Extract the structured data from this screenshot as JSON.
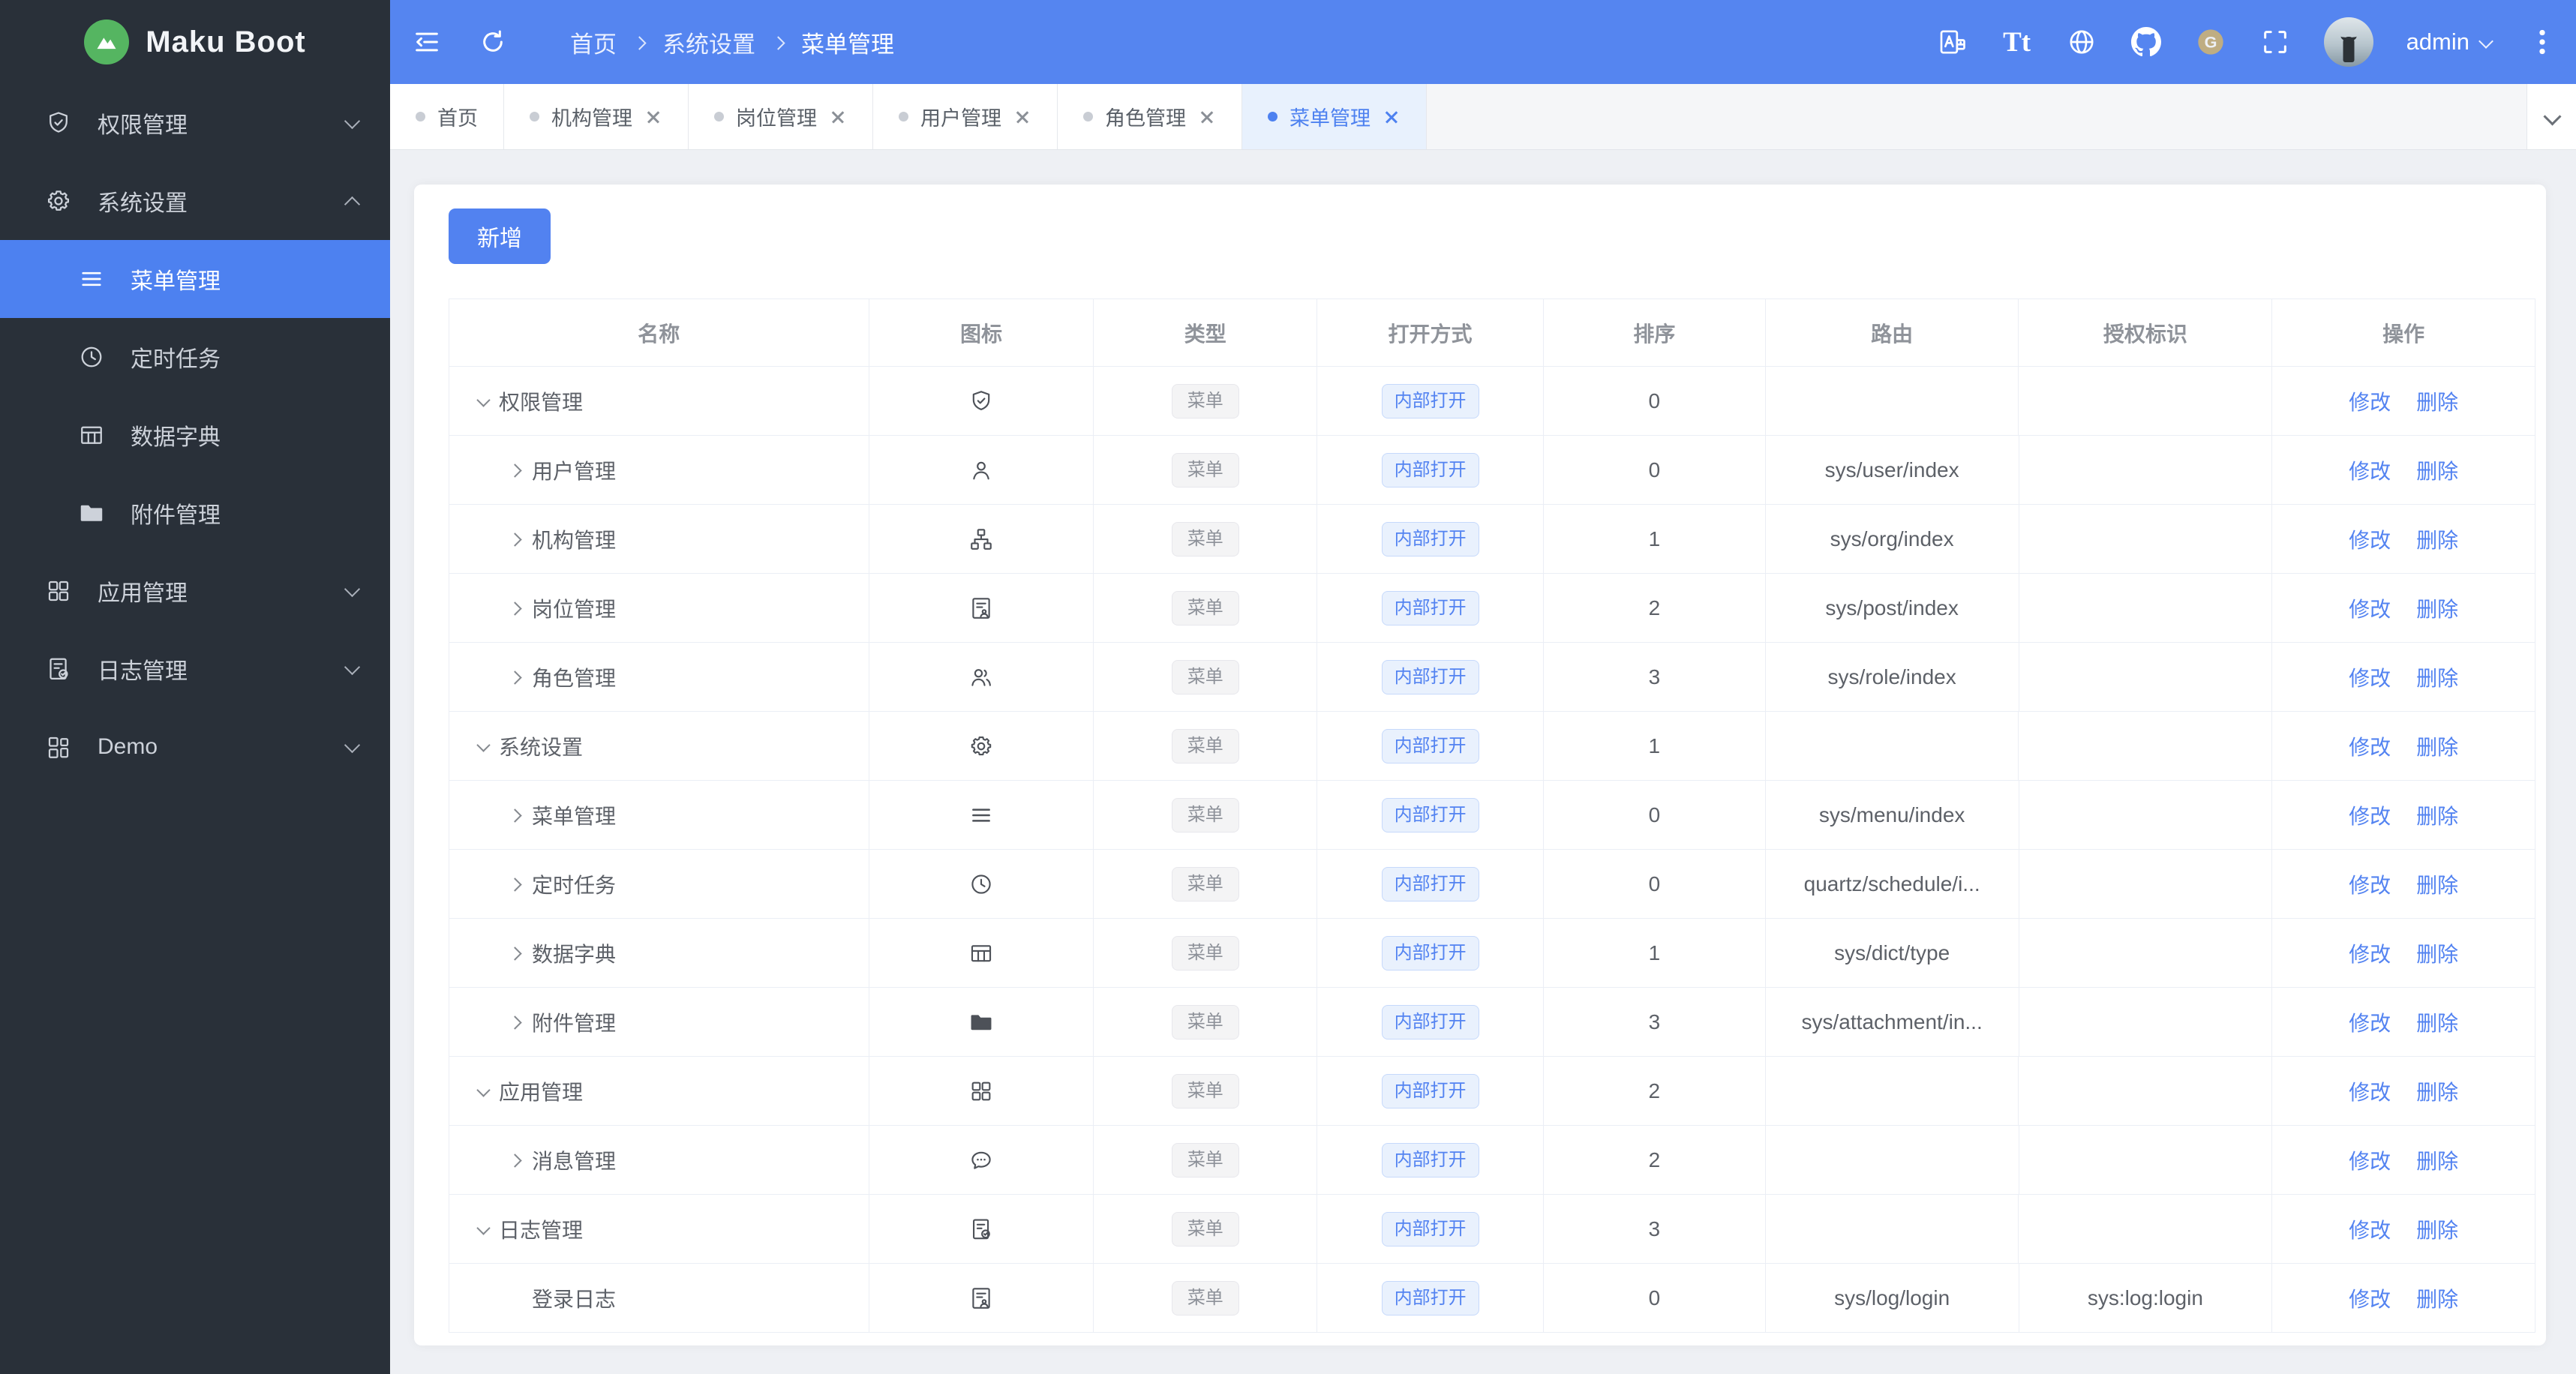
{
  "colors": {
    "primary": "#5282f0",
    "header_bg": "#5585f0",
    "sidebar_bg": "#293039",
    "sidebar_active_bg": "#4d81f0",
    "page_bg": "#eef0f4",
    "tab_active_bg": "#e8f1fd",
    "tag_info_bg": "#f4f4f5",
    "tag_primary_bg": "#e9f1fd",
    "logo_green": "#55b561",
    "gitee_gold": "#bfad82"
  },
  "brand": {
    "logo_text": "Maku Boot",
    "logo_icon": "mountain-icon"
  },
  "header": {
    "breadcrumb": {
      "items": [
        "首页",
        "系统设置",
        "菜单管理"
      ]
    },
    "left_icons": [
      "collapse-sidebar-icon",
      "refresh-icon"
    ],
    "right_icons": [
      "translate-icon",
      "font-size-icon",
      "globe-icon",
      "github-icon",
      "gitee-icon",
      "fullscreen-icon",
      "kebab-menu-icon"
    ],
    "font_size_glyph": "Tt",
    "gitee_letter": "G",
    "user": {
      "name": "admin"
    }
  },
  "sidebar": {
    "items": [
      {
        "label": "权限管理",
        "icon": "shield",
        "state": "collapsed"
      },
      {
        "label": "系统设置",
        "icon": "gear",
        "state": "expanded",
        "children": [
          {
            "label": "菜单管理",
            "icon": "menu",
            "active": true
          },
          {
            "label": "定时任务",
            "icon": "clock",
            "active": false
          },
          {
            "label": "数据字典",
            "icon": "dict",
            "active": false
          },
          {
            "label": "附件管理",
            "icon": "folder",
            "active": false
          }
        ]
      },
      {
        "label": "应用管理",
        "icon": "apps",
        "state": "collapsed"
      },
      {
        "label": "日志管理",
        "icon": "log",
        "state": "collapsed"
      },
      {
        "label": "Demo",
        "icon": "demo",
        "state": "collapsed"
      }
    ]
  },
  "tabs": {
    "items": [
      {
        "label": "首页",
        "closable": false,
        "active": false
      },
      {
        "label": "机构管理",
        "closable": true,
        "active": false
      },
      {
        "label": "岗位管理",
        "closable": true,
        "active": false
      },
      {
        "label": "用户管理",
        "closable": true,
        "active": false
      },
      {
        "label": "角色管理",
        "closable": true,
        "active": false
      },
      {
        "label": "菜单管理",
        "closable": true,
        "active": true
      }
    ]
  },
  "toolbar": {
    "add_label": "新增"
  },
  "table": {
    "headers": [
      "名称",
      "图标",
      "类型",
      "打开方式",
      "排序",
      "路由",
      "授权标识",
      "操作"
    ],
    "actions": {
      "modify": "修改",
      "delete": "删除"
    },
    "rows": [
      {
        "name": "权限管理",
        "icon": "shield",
        "level": 1,
        "expand": "expanded",
        "type": "菜单",
        "open": "内部打开",
        "sort": 0,
        "route": "",
        "auth": ""
      },
      {
        "name": "用户管理",
        "icon": "user",
        "level": 2,
        "expand": "collapsed",
        "type": "菜单",
        "open": "内部打开",
        "sort": 0,
        "route": "sys/user/index",
        "auth": ""
      },
      {
        "name": "机构管理",
        "icon": "org",
        "level": 2,
        "expand": "collapsed",
        "type": "菜单",
        "open": "内部打开",
        "sort": 1,
        "route": "sys/org/index",
        "auth": ""
      },
      {
        "name": "岗位管理",
        "icon": "post",
        "level": 2,
        "expand": "collapsed",
        "type": "菜单",
        "open": "内部打开",
        "sort": 2,
        "route": "sys/post/index",
        "auth": ""
      },
      {
        "name": "角色管理",
        "icon": "role",
        "level": 2,
        "expand": "collapsed",
        "type": "菜单",
        "open": "内部打开",
        "sort": 3,
        "route": "sys/role/index",
        "auth": ""
      },
      {
        "name": "系统设置",
        "icon": "gear",
        "level": 1,
        "expand": "expanded",
        "type": "菜单",
        "open": "内部打开",
        "sort": 1,
        "route": "",
        "auth": ""
      },
      {
        "name": "菜单管理",
        "icon": "menu",
        "level": 2,
        "expand": "collapsed",
        "type": "菜单",
        "open": "内部打开",
        "sort": 0,
        "route": "sys/menu/index",
        "auth": ""
      },
      {
        "name": "定时任务",
        "icon": "clock",
        "level": 2,
        "expand": "collapsed",
        "type": "菜单",
        "open": "内部打开",
        "sort": 0,
        "route": "quartz/schedule/i...",
        "auth": ""
      },
      {
        "name": "数据字典",
        "icon": "dict",
        "level": 2,
        "expand": "collapsed",
        "type": "菜单",
        "open": "内部打开",
        "sort": 1,
        "route": "sys/dict/type",
        "auth": ""
      },
      {
        "name": "附件管理",
        "icon": "folder",
        "level": 2,
        "expand": "collapsed",
        "type": "菜单",
        "open": "内部打开",
        "sort": 3,
        "route": "sys/attachment/in...",
        "auth": ""
      },
      {
        "name": "应用管理",
        "icon": "apps",
        "level": 1,
        "expand": "expanded",
        "type": "菜单",
        "open": "内部打开",
        "sort": 2,
        "route": "",
        "auth": ""
      },
      {
        "name": "消息管理",
        "icon": "message",
        "level": 2,
        "expand": "collapsed",
        "type": "菜单",
        "open": "内部打开",
        "sort": 2,
        "route": "",
        "auth": ""
      },
      {
        "name": "日志管理",
        "icon": "log",
        "level": 1,
        "expand": "expanded",
        "type": "菜单",
        "open": "内部打开",
        "sort": 3,
        "route": "",
        "auth": ""
      },
      {
        "name": "登录日志",
        "icon": "login",
        "level": 2,
        "expand": "none",
        "type": "菜单",
        "open": "内部打开",
        "sort": 0,
        "route": "sys/log/login",
        "auth": "sys:log:login"
      }
    ]
  }
}
